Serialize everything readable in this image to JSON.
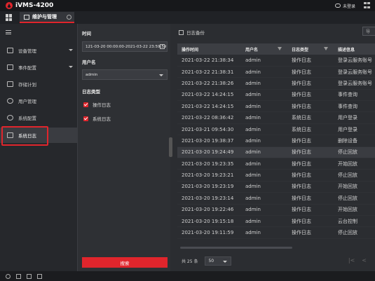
{
  "app": {
    "title": "iVMS-4200",
    "user_label": "未登录"
  },
  "tab": {
    "label": "维护与管理"
  },
  "nav": {
    "items": [
      {
        "label": "设备管理",
        "has_caret": true
      },
      {
        "label": "事件配置",
        "has_caret": true
      },
      {
        "label": "存储计划",
        "has_caret": false
      },
      {
        "label": "用户管理",
        "has_caret": false
      },
      {
        "label": "系统配置",
        "has_caret": false
      },
      {
        "label": "系统日志",
        "has_caret": false,
        "active": true
      }
    ]
  },
  "filter": {
    "time_label": "时间",
    "time_value": "121-03-20 00:00:00-2021-03-22 23:59:59",
    "user_label": "用户名",
    "user_value": "admin",
    "logtype_label": "日志类型",
    "logtypes": [
      {
        "label": "操作日志",
        "checked": true
      },
      {
        "label": "系统日志",
        "checked": true
      }
    ],
    "search_label": "搜索"
  },
  "main": {
    "title": "日志备份",
    "export_label": "导",
    "columns": [
      "操作时间",
      "用户名",
      "日志类型",
      "描述信息"
    ],
    "rows": [
      [
        "2021-03-22 21:38:34",
        "admin",
        "操作日志",
        "登录云服务账号"
      ],
      [
        "2021-03-22 21:38:31",
        "admin",
        "操作日志",
        "登录云服务账号"
      ],
      [
        "2021-03-22 21:38:26",
        "admin",
        "操作日志",
        "登录云服务账号"
      ],
      [
        "2021-03-22 14:24:15",
        "admin",
        "操作日志",
        "事件查询"
      ],
      [
        "2021-03-22 14:24:15",
        "admin",
        "操作日志",
        "事件查询"
      ],
      [
        "2021-03-22 08:36:42",
        "admin",
        "系统日志",
        "用户登录"
      ],
      [
        "2021-03-21 09:54:30",
        "admin",
        "系统日志",
        "用户登录"
      ],
      [
        "2021-03-20 19:38:37",
        "admin",
        "操作日志",
        "删除设备"
      ],
      [
        "2021-03-20 19:24:49",
        "admin",
        "操作日志",
        "停止回放"
      ],
      [
        "2021-03-20 19:23:35",
        "admin",
        "操作日志",
        "开始回放"
      ],
      [
        "2021-03-20 19:23:21",
        "admin",
        "操作日志",
        "停止回放"
      ],
      [
        "2021-03-20 19:23:19",
        "admin",
        "操作日志",
        "开始回放"
      ],
      [
        "2021-03-20 19:23:14",
        "admin",
        "操作日志",
        "停止回放"
      ],
      [
        "2021-03-20 19:22:46",
        "admin",
        "操作日志",
        "开始回放"
      ],
      [
        "2021-03-20 19:15:18",
        "admin",
        "操作日志",
        "云台控制"
      ],
      [
        "2021-03-20 19:11:59",
        "admin",
        "操作日志",
        "停止回放"
      ]
    ],
    "highlight_row": 8,
    "total_text": "共 25 条",
    "page_size": "50"
  },
  "colors": {
    "accent": "#e0252c",
    "bg": "#2b2d31"
  }
}
